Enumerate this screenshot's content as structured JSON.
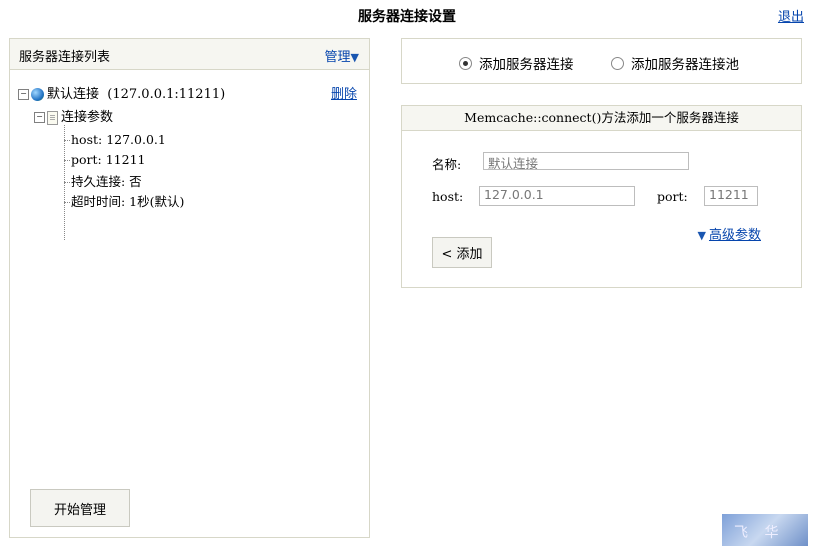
{
  "header": {
    "title": "服务器连接设置",
    "logout": "退出"
  },
  "left": {
    "panel_title": "服务器连接列表",
    "manage_label": "管理",
    "manage_arrow": "▼",
    "tree": {
      "root_label": "默认连接",
      "root_address": "(127.0.0.1:11211)",
      "delete_label": "删除",
      "params_label": "连接参数",
      "leaves": [
        "host: 127.0.0.1",
        "port: 11211",
        "持久连接: 否",
        "超时时间: 1秒(默认)"
      ]
    },
    "start_button": "开始管理"
  },
  "right": {
    "radio_options": [
      {
        "label": "添加服务器连接",
        "checked": true
      },
      {
        "label": "添加服务器连接池",
        "checked": false
      }
    ],
    "form": {
      "header": "Memcache::connect()方法添加一个服务器连接",
      "name_label": "名称:",
      "name_value": "默认连接",
      "host_label": "host:",
      "host_value": "127.0.0.1",
      "port_label": "port:",
      "port_value": "11211",
      "advanced_label": "高级参数",
      "advanced_arrow": "▼",
      "add_button": "< 添加"
    }
  }
}
